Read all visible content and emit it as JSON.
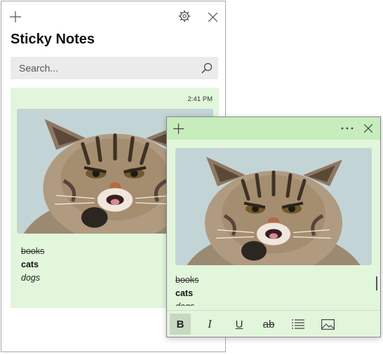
{
  "list_window": {
    "title": "Sticky Notes",
    "search": {
      "placeholder": "Search..."
    },
    "note": {
      "time": "2:41 PM",
      "lines": [
        "books",
        "cats",
        "dogs"
      ]
    }
  },
  "editor": {
    "lines": [
      "books",
      "cats",
      "dogs"
    ],
    "toolbar": {
      "bold": "B",
      "italic": "I",
      "underline": "U",
      "strike": "ab"
    }
  },
  "colors": {
    "note_background": "#e2f6dc",
    "editor_titlebar": "#c6edbb",
    "search_background": "#ebebeb"
  },
  "icons": {
    "add": "plus-icon",
    "settings": "gear-icon",
    "close": "close-icon",
    "search": "search-icon",
    "more": "more-icon",
    "bullets": "bullet-list-icon",
    "image": "image-icon"
  }
}
